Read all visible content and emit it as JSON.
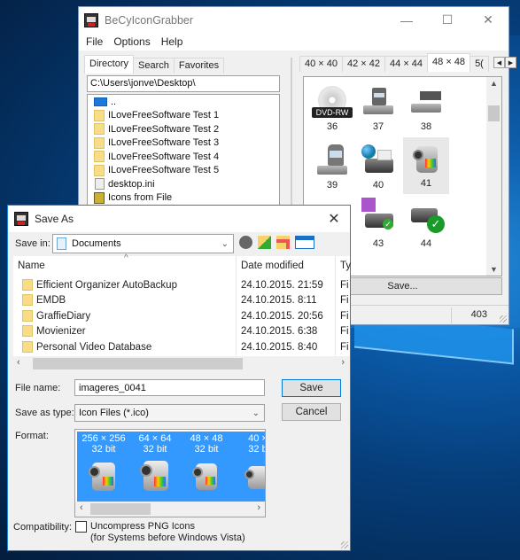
{
  "main_window": {
    "title": "BeCyIconGrabber",
    "controls": {
      "minimize": "—",
      "maximize": "☐",
      "close": "✕"
    },
    "menu": [
      "File",
      "Options",
      "Help"
    ],
    "left_tabs": [
      "Directory",
      "Search",
      "Favorites"
    ],
    "active_left_tab": "Directory",
    "path": "C:\\Users\\jonve\\Desktop\\",
    "files": [
      {
        "icon": "parent-dir",
        "label": ".."
      },
      {
        "icon": "folder",
        "label": "ILoveFreeSoftware Test 1"
      },
      {
        "icon": "folder",
        "label": "ILoveFreeSoftware Test 2"
      },
      {
        "icon": "folder",
        "label": "ILoveFreeSoftware Test 3"
      },
      {
        "icon": "folder",
        "label": "ILoveFreeSoftware Test 4"
      },
      {
        "icon": "folder",
        "label": "ILoveFreeSoftware Test 5"
      },
      {
        "icon": "ini-file",
        "label": "desktop.ini"
      },
      {
        "icon": "icons-from-file",
        "label": "Icons from File"
      }
    ],
    "size_tabs": [
      "40 × 40",
      "42 × 42",
      "44 × 44",
      "48 × 48",
      "5("
    ],
    "active_size_tab": "48 × 48",
    "icons": [
      {
        "num": "36",
        "kind": "dvd-rw",
        "badge": "DVD-RW"
      },
      {
        "num": "37",
        "kind": "drive-sd"
      },
      {
        "num": "38",
        "kind": "drive-tape"
      },
      {
        "num": "39",
        "kind": "drive-card"
      },
      {
        "num": "40",
        "kind": "network-printer"
      },
      {
        "num": "41",
        "kind": "camcorder",
        "selected": true
      },
      {
        "num": "43",
        "kind": "printer-floppy-check"
      },
      {
        "num": "44",
        "kind": "printer-check"
      }
    ],
    "save_button": "Save...",
    "status_count": "403"
  },
  "dialog": {
    "title": "Save As",
    "save_in_label": "Save in:",
    "save_in_value": "Documents",
    "columns": [
      "Name",
      "Date modified",
      "Ty"
    ],
    "rows": [
      {
        "name": "Efficient Organizer AutoBackup",
        "date": "24.10.2015. 21:59",
        "type": "Fi"
      },
      {
        "name": "EMDB",
        "date": "24.10.2015. 8:11",
        "type": "Fi"
      },
      {
        "name": "GraffieDiary",
        "date": "24.10.2015. 20:56",
        "type": "Fi"
      },
      {
        "name": "Movienizer",
        "date": "24.10.2015. 6:38",
        "type": "Fi"
      },
      {
        "name": "Personal Video Database",
        "date": "24.10.2015. 8:40",
        "type": "Fi"
      }
    ],
    "file_name_label": "File name:",
    "file_name_value": "imageres_0041",
    "save_as_type_label": "Save as type:",
    "save_as_type_value": "Icon Files (*.ico)",
    "save_button": "Save",
    "cancel_button": "Cancel",
    "format_label": "Format:",
    "formats": [
      {
        "size": "256 × 256",
        "depth": "32 bit"
      },
      {
        "size": "64 × 64",
        "depth": "32 bit"
      },
      {
        "size": "48 × 48",
        "depth": "32 bit"
      },
      {
        "size": "40 ×",
        "depth": "32 b"
      }
    ],
    "compatibility_label": "Compatibility:",
    "compat_checkbox_checked": false,
    "compat_line1": "Uncompress PNG Icons",
    "compat_line2": "(for Systems before Windows Vista)"
  }
}
